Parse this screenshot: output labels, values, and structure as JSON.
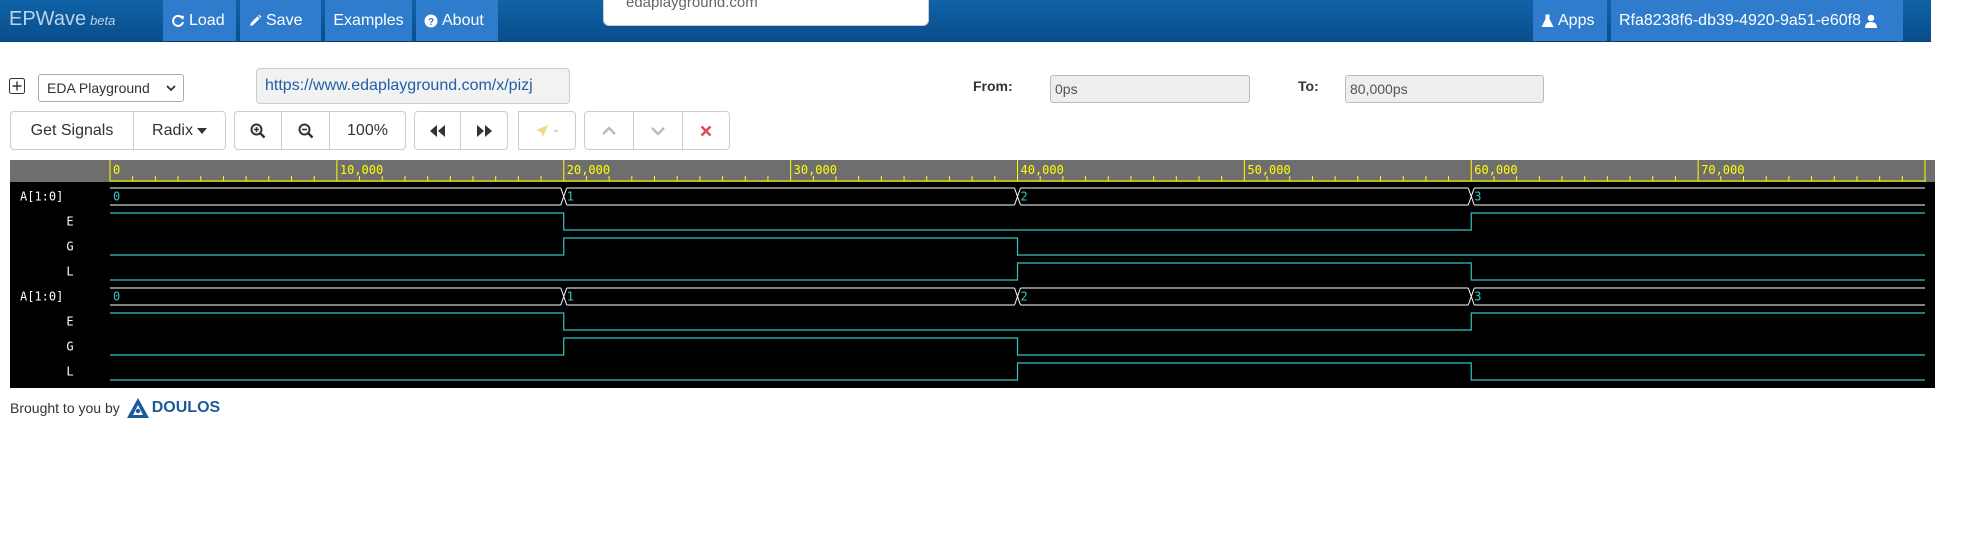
{
  "navbar": {
    "brand": "EPWave",
    "beta": "beta",
    "load": "Load",
    "save": "Save",
    "examples": "Examples",
    "about": "About",
    "apps": "Apps",
    "user": "Rfa8238f6-db39-4920-9a51-e60f8"
  },
  "popup": {
    "text": "edaplayground.com"
  },
  "toolbar": {
    "source_select": "EDA Playground",
    "url": "https://www.edaplayground.com/x/pizj",
    "from_label": "From:",
    "from_value": "0ps",
    "to_label": "To:",
    "to_value": "80,000ps",
    "get_signals": "Get Signals",
    "radix": "Radix",
    "zoom_level": "100%",
    "marker_label": "-"
  },
  "colors": {
    "navbar": "#0f63a8",
    "nav_button": "#2f7ccc",
    "wave_background": "#000000",
    "timeline": "#6e6e6e",
    "timeline_text": "#ffff00",
    "wave_line": "#35c4c4",
    "bus_line": "#ffffff",
    "delete": "#e05050"
  },
  "waveform": {
    "time_start": 0,
    "time_end": 80000,
    "tick_labels": [
      "0",
      "10,000",
      "20,000",
      "30,000",
      "40,000",
      "50,000",
      "60,000",
      "70,000"
    ],
    "signals": [
      {
        "name": "A[1:0]",
        "type": "bus",
        "segments": [
          {
            "t": 0,
            "label": "0"
          },
          {
            "t": 20000,
            "label": "1"
          },
          {
            "t": 40000,
            "label": "2"
          },
          {
            "t": 60000,
            "label": "3"
          }
        ]
      },
      {
        "name": "E",
        "type": "bit",
        "changes": [
          {
            "t": 0,
            "v": 1
          },
          {
            "t": 20000,
            "v": 0
          },
          {
            "t": 60000,
            "v": 1
          }
        ]
      },
      {
        "name": "G",
        "type": "bit",
        "changes": [
          {
            "t": 0,
            "v": 0
          },
          {
            "t": 20000,
            "v": 1
          },
          {
            "t": 40000,
            "v": 0
          }
        ]
      },
      {
        "name": "L",
        "type": "bit",
        "changes": [
          {
            "t": 0,
            "v": 0
          },
          {
            "t": 40000,
            "v": 1
          },
          {
            "t": 60000,
            "v": 0
          }
        ]
      },
      {
        "name": "A[1:0]",
        "type": "bus",
        "segments": [
          {
            "t": 0,
            "label": "0"
          },
          {
            "t": 20000,
            "label": "1"
          },
          {
            "t": 40000,
            "label": "2"
          },
          {
            "t": 60000,
            "label": "3"
          }
        ]
      },
      {
        "name": "E",
        "type": "bit",
        "changes": [
          {
            "t": 0,
            "v": 1
          },
          {
            "t": 20000,
            "v": 0
          },
          {
            "t": 60000,
            "v": 1
          }
        ]
      },
      {
        "name": "G",
        "type": "bit",
        "changes": [
          {
            "t": 0,
            "v": 0
          },
          {
            "t": 20000,
            "v": 1
          },
          {
            "t": 40000,
            "v": 0
          }
        ]
      },
      {
        "name": "L",
        "type": "bit",
        "changes": [
          {
            "t": 0,
            "v": 0
          },
          {
            "t": 40000,
            "v": 1
          },
          {
            "t": 60000,
            "v": 0
          }
        ]
      }
    ]
  },
  "footer": {
    "text": "Brought to you by",
    "logo": "DOULOS"
  },
  "icons": {
    "load": "refresh-icon",
    "save": "pencil-icon",
    "about": "question-circle-icon",
    "apps": "flask-icon",
    "user": "user-icon",
    "expand": "plus-square-icon",
    "zoom_in": "zoom-in-icon",
    "zoom_out": "zoom-out-icon",
    "prev": "fast-backward-icon",
    "next": "fast-forward-icon",
    "marker": "cursor-icon",
    "up": "chevron-up-icon",
    "down": "chevron-down-icon",
    "delete": "close-icon"
  }
}
